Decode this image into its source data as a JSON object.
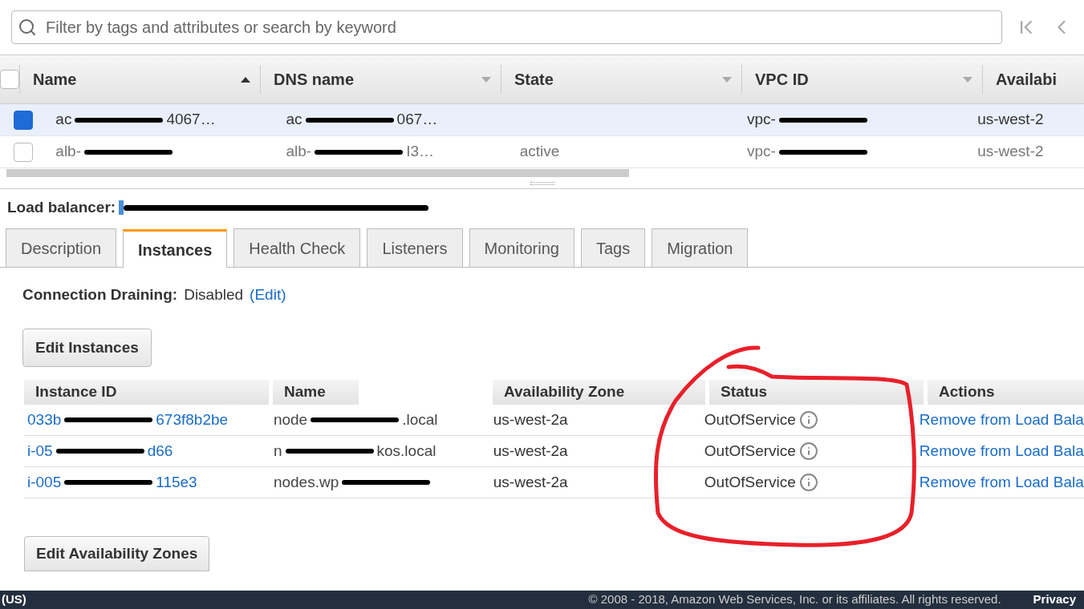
{
  "search": {
    "placeholder": "Filter by tags and attributes or search by keyword"
  },
  "lb_table": {
    "all_selected": false,
    "columns": [
      {
        "label": "Name",
        "sorted": true
      },
      {
        "label": "DNS name",
        "sorted": false
      },
      {
        "label": "State",
        "sorted": false
      },
      {
        "label": "VPC ID",
        "sorted": false
      },
      {
        "label": "Availabi"
      }
    ],
    "rows": [
      {
        "selected": true,
        "name": [
          "ac",
          "4067…"
        ],
        "dns": [
          "ac",
          "067…"
        ],
        "vpc": [
          "vpc-"
        ],
        "zone": "us-west-2"
      },
      {
        "selected": false,
        "name": [
          "alb-"
        ],
        "dns": [
          "alb-",
          "I3…"
        ],
        "state": "active",
        "vpc": [
          "vpc-"
        ],
        "zone": "us-west-2"
      }
    ]
  },
  "load_balancer": {
    "label": "Load balancer:"
  },
  "tabs": [
    {
      "label": "Description",
      "selected": false
    },
    {
      "label": "Instances",
      "selected": true
    },
    {
      "label": "Health Check",
      "selected": false
    },
    {
      "label": "Listeners",
      "selected": false
    },
    {
      "label": "Monitoring",
      "selected": false
    },
    {
      "label": "Tags",
      "selected": false
    },
    {
      "label": "Migration",
      "selected": false
    }
  ],
  "connection_draining": {
    "label": "Connection Draining:",
    "value": "Disabled",
    "link": "(Edit)"
  },
  "edit_instances": "Edit Instances",
  "instances": {
    "columns": [
      {
        "label": "Instance ID"
      },
      {
        "label": "Name"
      },
      {},
      {
        "label": "Availability Zone"
      },
      {
        "label": "Status"
      },
      {
        "label": "Actions"
      }
    ],
    "rows": [
      {
        "id": [
          "033b",
          "673f8b2be"
        ],
        "name": [
          "node",
          ".local"
        ],
        "zone": "us-west-2a",
        "status": "OutOfService",
        "action": "Remove from Load Bala"
      },
      {
        "id": [
          "i-05",
          "d66"
        ],
        "name": [
          "n",
          "kos.local"
        ],
        "zone": "us-west-2a",
        "status": "OutOfService",
        "action": "Remove from Load Bala"
      },
      {
        "id": [
          "i-005",
          "115e3"
        ],
        "name": [
          "nodes.wp"
        ],
        "zone": "us-west-2a",
        "status": "OutOfService",
        "action": "Remove from Load Bala"
      }
    ]
  },
  "edit_zones": "Edit Availability Zones",
  "footer": {
    "region": "(US)",
    "copyright": "© 2008 - 2018, Amazon Web Services, Inc. or its affiliates. All rights reserved.",
    "privacy": "Privacy"
  }
}
